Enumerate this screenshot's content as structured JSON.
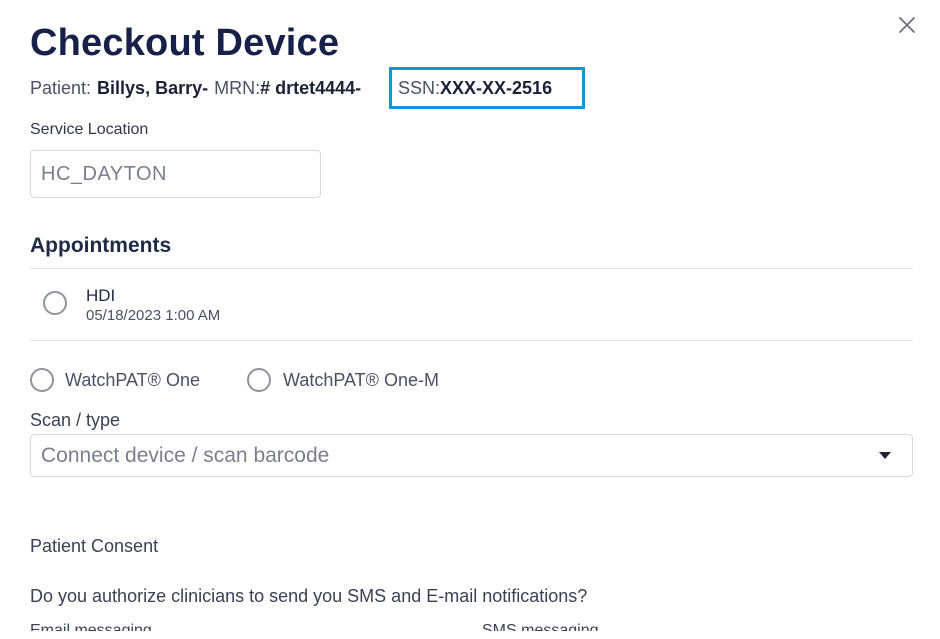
{
  "dialog": {
    "title": "Checkout Device",
    "close_icon": "close-icon"
  },
  "patient": {
    "patient_label": "Patient:",
    "patient_name": "Billys, Barry-",
    "mrn_label": "MRN:",
    "mrn_value": "# drtet4444-",
    "ssn_label": "SSN:",
    "ssn_value": "XXX-XX-2516",
    "highlight_color": "#1296d8"
  },
  "service_location": {
    "label": "Service Location",
    "value": "HC_DAYTON"
  },
  "appointments": {
    "title": "Appointments",
    "items": [
      {
        "name": "HDI",
        "datetime": "05/18/2023 1:00 AM",
        "selected": false
      }
    ]
  },
  "devices": {
    "options": [
      {
        "label": "WatchPAT® One",
        "selected": false
      },
      {
        "label": "WatchPAT® One-M",
        "selected": false
      }
    ]
  },
  "scan": {
    "label": "Scan / type",
    "placeholder": "Connect device / scan barcode",
    "caret_icon": "caret-down-icon"
  },
  "consent": {
    "title": "Patient Consent",
    "question": "Do you authorize clinicians to send you SMS and E-mail notifications?",
    "email_label": "Email messaging",
    "sms_label": "SMS messaging"
  }
}
